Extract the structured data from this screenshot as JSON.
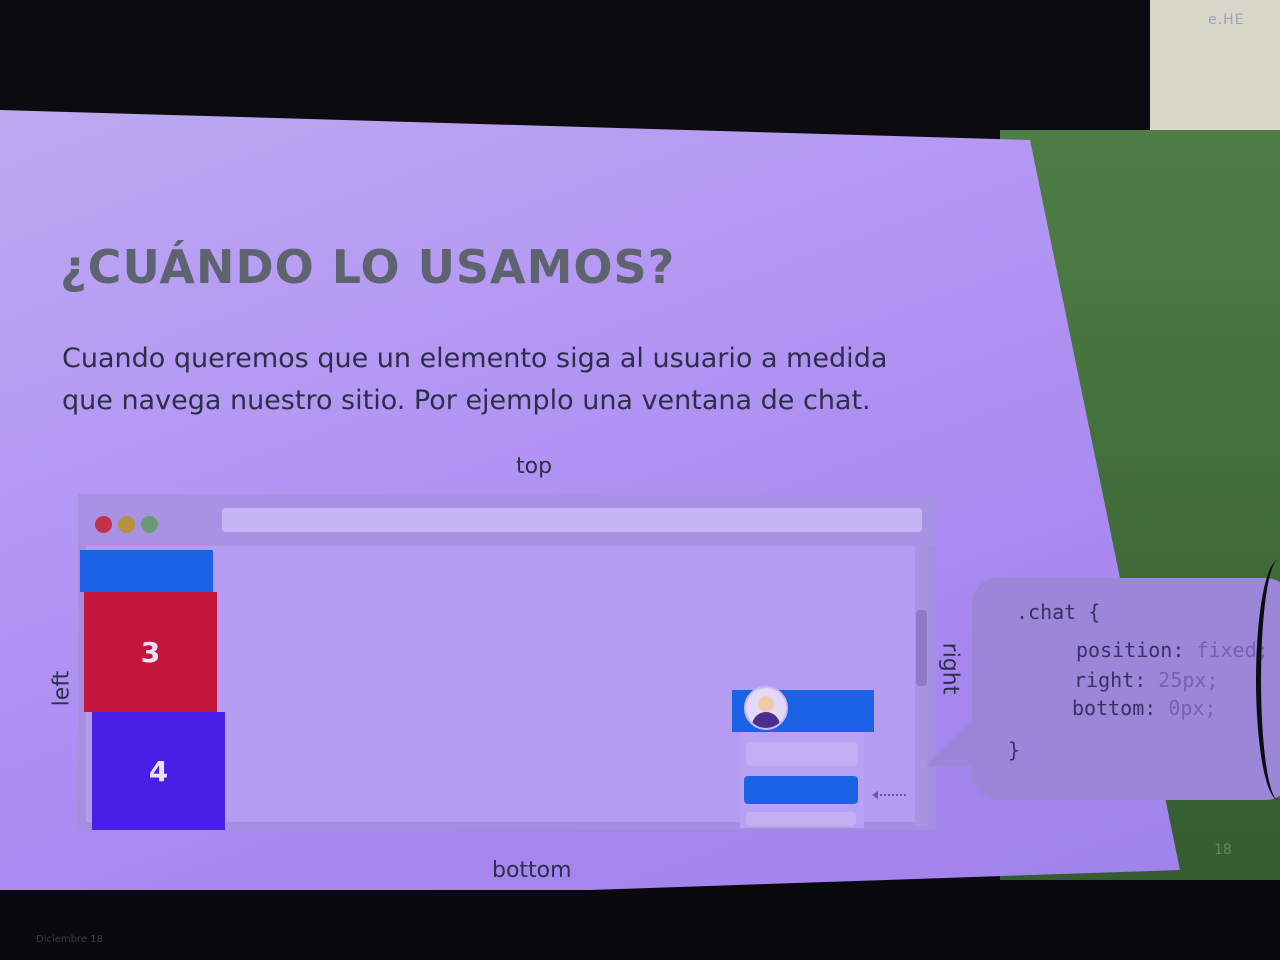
{
  "paper_note": "e.HE",
  "slide": {
    "title": "¿CUÁNDO LO USAMOS?",
    "body_line1": "Cuando queremos que un elemento siga al usuario a medida",
    "body_line2": "que navega nuestro sitio. Por ejemplo una ventana de chat."
  },
  "diagram": {
    "label_top": "top",
    "label_bottom": "bottom",
    "label_left": "left",
    "label_right": "right",
    "block_3": "3",
    "block_4": "4"
  },
  "code": {
    "open": ".chat {",
    "line1_prop": "position:",
    "line1_val": "fixed;",
    "line2_prop": "right:",
    "line2_val": "25px;",
    "line3_prop": "bottom:",
    "line3_val": "0px;",
    "close": "}"
  },
  "page_number": "18",
  "taskbar": {
    "date": "Diciembre 18"
  },
  "colors": {
    "slide_bg": "#b497f4",
    "title": "#5d6470",
    "blue_block": "#1a63e6",
    "red_block": "#c4163a",
    "purple_block": "#4a1ee6"
  }
}
